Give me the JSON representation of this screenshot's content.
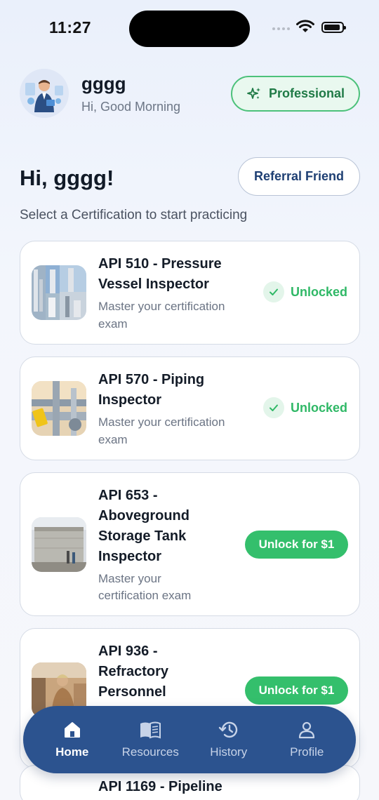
{
  "status_bar": {
    "time": "11:27"
  },
  "header": {
    "user_name": "gggg",
    "greeting": "Hi, Good Morning",
    "plan_badge": "Professional",
    "avatar_icon": "user-avatar-illustration"
  },
  "welcome": {
    "title": "Hi, gggg!",
    "referral_button": "Referral Friend",
    "subtitle": "Select a Certification to start practicing"
  },
  "certifications": [
    {
      "title_line1": "API 510 - Pressure",
      "title_line2": "Vessel Inspector",
      "title_line3": "",
      "title_line4": "",
      "desc_line1": "Master your certification",
      "desc_line2": "exam",
      "status": "Unlocked"
    },
    {
      "title_line1": "API 570 - Piping",
      "title_line2": "Inspector",
      "title_line3": "",
      "title_line4": "",
      "desc_line1": "Master your certification",
      "desc_line2": "exam",
      "status": "Unlocked"
    },
    {
      "title_line1": "API 653 -",
      "title_line2": "Aboveground",
      "title_line3": "Storage Tank",
      "title_line4": "Inspector",
      "desc_line1": "Master your",
      "desc_line2": "certification exam",
      "status": "Unlock for $1"
    },
    {
      "title_line1": "API 936 -",
      "title_line2": "Refractory",
      "title_line3": "Personnel",
      "title_line4": "",
      "desc_line1": "",
      "desc_line2": "",
      "status": "Unlock for $1"
    },
    {
      "title_line1": "API 1169 - Pipeline",
      "title_line2": "",
      "title_line3": "",
      "title_line4": "",
      "desc_line1": "",
      "desc_line2": "",
      "status": ""
    }
  ],
  "nav": [
    {
      "label": "Home",
      "icon": "home-icon",
      "active": true
    },
    {
      "label": "Resources",
      "icon": "book-icon",
      "active": false
    },
    {
      "label": "History",
      "icon": "history-icon",
      "active": false
    },
    {
      "label": "Profile",
      "icon": "user-icon",
      "active": false
    }
  ],
  "colors": {
    "accent_green": "#34bf6c",
    "nav_bg": "#2c538f",
    "title_navy": "#1e3f73"
  }
}
